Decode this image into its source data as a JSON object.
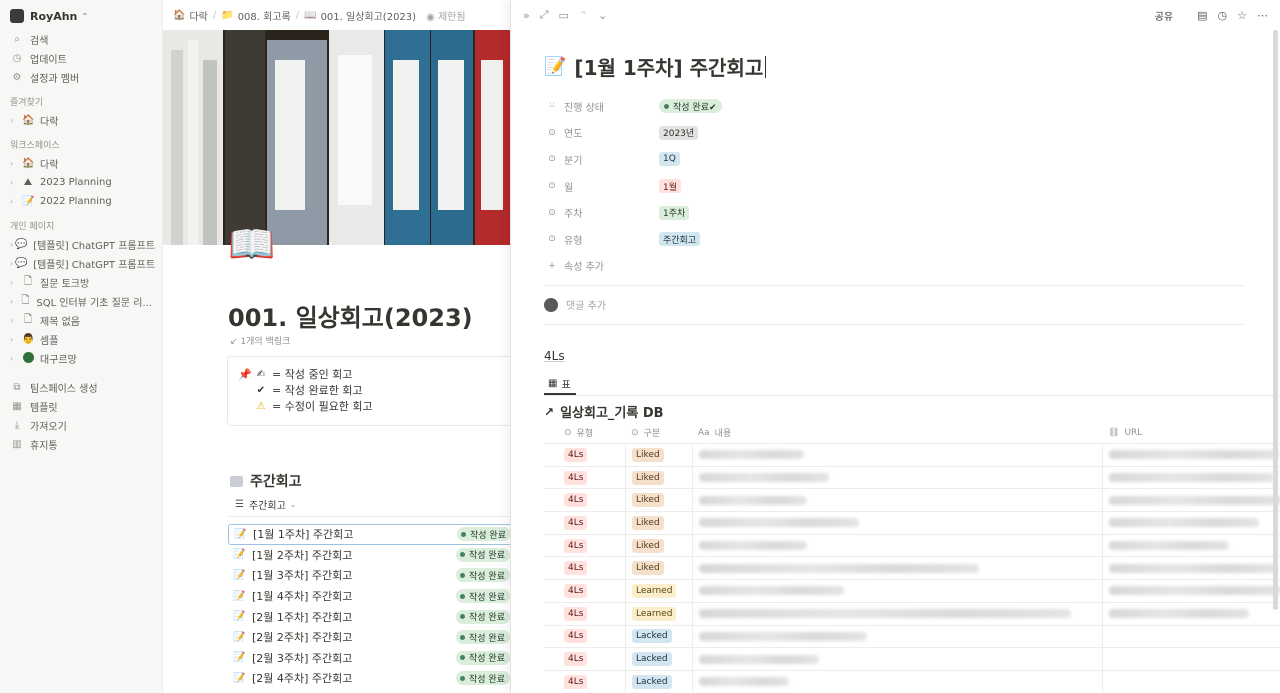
{
  "sidebar": {
    "workspace": "RoyAhn",
    "top_items": [
      {
        "icon": "search-icon",
        "glyph": "⌕",
        "label": "검색"
      },
      {
        "icon": "updates-icon",
        "glyph": "◷",
        "label": "업데이트"
      },
      {
        "icon": "settings-icon",
        "glyph": "⚙",
        "label": "설정과 멤버"
      }
    ],
    "favorites_header": "즐겨찾기",
    "favorites": [
      {
        "emoji": "🏠",
        "label": "다락"
      }
    ],
    "workspace_header": "워크스페이스",
    "workspace_items": [
      {
        "emoji": "🏠",
        "label": "다락"
      },
      {
        "emoji": "⛰",
        "label": "2023 Planning"
      },
      {
        "emoji": "📝",
        "label": "2022 Planning"
      }
    ],
    "private_header": "개인 페이지",
    "private_items": [
      {
        "emoji": "💬",
        "label": "[템플릿] ChatGPT 프롬프트"
      },
      {
        "emoji": "💬",
        "label": "[템플릿] ChatGPT 프롬프트"
      },
      {
        "emoji": "📄",
        "label": "질문 토크방"
      },
      {
        "emoji": "📄",
        "label": "SQL 인터뷰 기초 질문 리..."
      },
      {
        "emoji": "📄",
        "label": "제목 없음"
      },
      {
        "emoji": "👨",
        "label": "셈플"
      },
      {
        "emoji": "●",
        "label": "대구르망"
      }
    ],
    "bottom_items": [
      {
        "icon": "teamspace-icon",
        "glyph": "⧉",
        "label": "팀스페이스 생성"
      },
      {
        "icon": "templates-icon",
        "glyph": "▦",
        "label": "템플릿"
      },
      {
        "icon": "import-icon",
        "glyph": "⭳",
        "label": "가져오기"
      },
      {
        "icon": "trash-icon",
        "glyph": "🗑",
        "label": "휴지통"
      }
    ]
  },
  "main": {
    "breadcrumb": [
      {
        "emoji": "🏠",
        "label": "다락"
      },
      {
        "emoji": "📁",
        "label": "008. 회고록"
      },
      {
        "emoji": "📖",
        "label": "001. 일상회고(2023)"
      }
    ],
    "permission": "제한됨",
    "page_icon": "📖",
    "title": "001. 일상회고(2023)",
    "backlinks": "1개의 백링크",
    "callout": {
      "pin": "📌",
      "lines": [
        {
          "emoji": "✍",
          "text": "= 작성 중인 회고"
        },
        {
          "emoji": "✔",
          "text": "= 작성 완료한 회고"
        },
        {
          "emoji": "⚠",
          "text": "= 수정이 필요한 회고"
        }
      ]
    },
    "section_title": "주간회고",
    "view_label": "주간회고",
    "weekly_rows": [
      {
        "title": "[1월 1주차] 주간회고",
        "status": "작성 완료"
      },
      {
        "title": "[1월 2주차] 주간회고",
        "status": "작성 완료"
      },
      {
        "title": "[1월 3주차] 주간회고",
        "status": "작성 완료"
      },
      {
        "title": "[1월 4주차] 주간회고",
        "status": "작성 완료"
      },
      {
        "title": "[2월 1주차] 주간회고",
        "status": "작성 완료"
      },
      {
        "title": "[2월 2주차] 주간회고",
        "status": "작성 완료"
      },
      {
        "title": "[2월 3주차] 주간회고",
        "status": "작성 완료"
      },
      {
        "title": "[2월 4주차] 주간회고",
        "status": "작성 완료"
      }
    ]
  },
  "peek": {
    "share_label": "공유",
    "title_icon": "📝",
    "title": "[1월 1주차] 주간회고",
    "properties": [
      {
        "label": "진행 상태",
        "value": "작성 완료✔",
        "style": "green-pill"
      },
      {
        "label": "연도",
        "value": "2023년",
        "style": "gray"
      },
      {
        "label": "분기",
        "value": "1Q",
        "style": "blue"
      },
      {
        "label": "월",
        "value": "1월",
        "style": "red"
      },
      {
        "label": "주차",
        "value": "1주차",
        "style": "green"
      },
      {
        "label": "유형",
        "value": "주간회고",
        "style": "blue"
      }
    ],
    "add_property": "속성 추가",
    "comment_placeholder": "댓글 추가",
    "heading": "4Ls",
    "db_view_tab": "표",
    "db_title": "일상회고_기록 DB",
    "columns": {
      "type": "유형",
      "category": "구분",
      "content": "내용",
      "url": "URL",
      "content_prefix": "Aa"
    },
    "rows": [
      {
        "type": "4Ls",
        "category": "Liked"
      },
      {
        "type": "4Ls",
        "category": "Liked"
      },
      {
        "type": "4Ls",
        "category": "Liked"
      },
      {
        "type": "4Ls",
        "category": "Liked"
      },
      {
        "type": "4Ls",
        "category": "Liked"
      },
      {
        "type": "4Ls",
        "category": "Liked"
      },
      {
        "type": "4Ls",
        "category": "Learned"
      },
      {
        "type": "4Ls",
        "category": "Learned"
      },
      {
        "type": "4Ls",
        "category": "Lacked"
      },
      {
        "type": "4Ls",
        "category": "Lacked"
      },
      {
        "type": "4Ls",
        "category": "Lacked"
      }
    ]
  }
}
